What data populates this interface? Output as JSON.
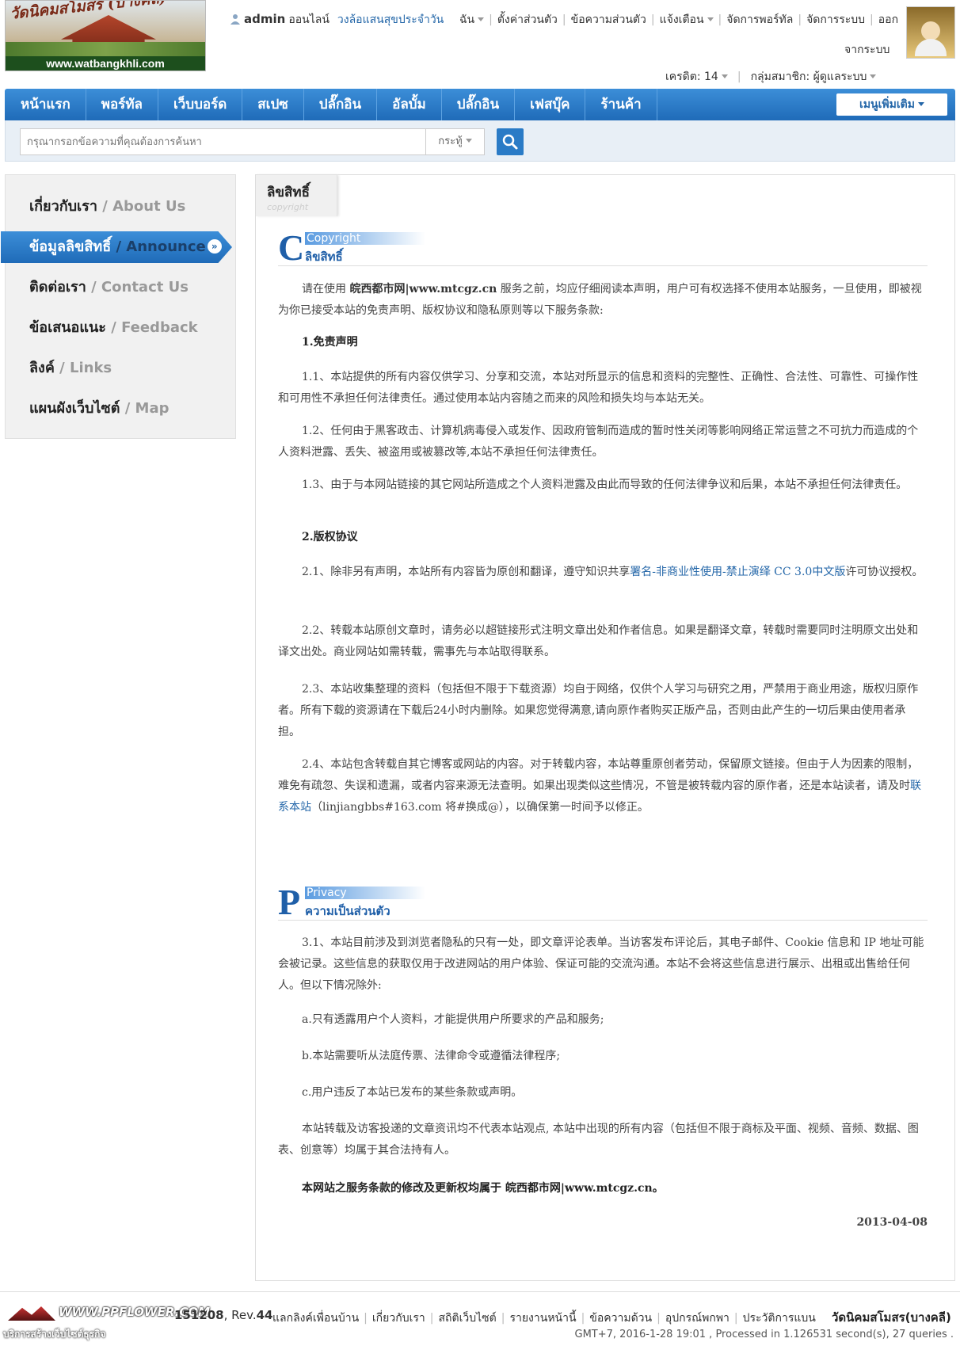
{
  "logo": {
    "title": "วัดนิคมสโมสร (บางคลี)",
    "url": "www.watbangkhli.com"
  },
  "topbar": {
    "username": "admin",
    "online": "ออนไลน์",
    "daily": "วงล้อแสนสุขประจำวัน",
    "links": [
      "ฉัน",
      "ตั้งค่าส่วนตัว",
      "ข้อความส่วนตัว",
      "แจ้งเตือน",
      "จัดการพอร์ทัล",
      "จัดการระบบ",
      "ออก"
    ],
    "logout_line2": "จากระบบ",
    "credits": "เครดิต: 14",
    "group": "กลุ่มสมาชิก: ผู้ดูแลระบบ"
  },
  "nav": {
    "items": [
      "หน้าแรก",
      "พอร์ทัล",
      "เว็บบอร์ด",
      "สเปซ",
      "ปลั๊กอิน",
      "อัลบั้ม",
      "ปลั๊กอิน",
      "เฟสบุ๊ค",
      "ร้านค้า"
    ],
    "more": "เมนูเพิ่มเติม"
  },
  "search": {
    "placeholder": "กรุณากรอกข้อความที่คุณต้องการค้นหา",
    "type": "กระทู้"
  },
  "sidebar": {
    "items": [
      {
        "th": "เกี่ยวกับเรา",
        "en": "/ About Us"
      },
      {
        "th": "ข้อมูลลิขสิทธิ์",
        "en": "/ Announce"
      },
      {
        "th": "ติดต่อเรา",
        "en": "/ Contact Us"
      },
      {
        "th": "ข้อเสนอแนะ",
        "en": "/ Feedback"
      },
      {
        "th": "ลิงค์",
        "en": "/ Links"
      },
      {
        "th": "แผนผังเว็บไซต์",
        "en": "/ Map"
      }
    ]
  },
  "tab": {
    "title": "ลิขสิทธิ์",
    "sub": "copyright"
  },
  "sec1": {
    "letter": "C",
    "en": "Copyright",
    "th": "ลิขสิทธิ์"
  },
  "sec2": {
    "letter": "P",
    "en": "Privacy",
    "th": "ความเป็นส่วนตัว"
  },
  "content": {
    "intro_a": "请在使用 ",
    "intro_site": "皖西都市网|www.mtcgz.cn",
    "intro_b": " 服务之前，均应仔细阅读本声明，用户可有权选择不使用本站服务，一旦使用，即被视为你已接受本站的免责声明、版权协议和隐私原则等以下服务条款:",
    "h1": "1.免责声明",
    "p11": "1.1、本站提供的所有内容仅供学习、分享和交流，本站对所显示的信息和资料的完整性、正确性、合法性、可靠性、可操作性和可用性不承担任何法律责任。通过使用本站内容随之而来的风险和损失均与本站无关。",
    "p12": "1.2、任何由于黑客政击、计算机病毒侵入或发作、因政府管制而造成的暂时性关闭等影响网络正常运营之不可抗力而造成的个人资料泄露、丢失、被盗用或被篡改等,本站不承担任何法律责任。",
    "p13": "1.3、由于与本网站链接的其它网站所造成之个人资料泄露及由此而导致的任何法律争议和后果，本站不承担任何法律责任。",
    "h2": "2.版权协议",
    "p21_a": "2.1、除非另有声明，本站所有内容皆为原创和翻译，遵守知识共享",
    "p21_link": "署名-非商业性使用-禁止演绎 CC 3.0中文版",
    "p21_b": "许可协议授权。",
    "p22": "2.2、转载本站原创文章时，请务必以超链接形式注明文章出处和作者信息。如果是翻译文章，转载时需要同时注明原文出处和译文出处。商业网站如需转载，需事先与本站取得联系。",
    "p23": "2.3、本站收集整理的资料（包括但不限于下载资源）均自于网络，仅供个人学习与研究之用，严禁用于商业用途，版权归原作者。所有下载的资源请在下载后24小时内删除。如果您觉得满意,请向原作者购买正版产品，否则由此产生的一切后果由使用者承担。",
    "p24_a": "2.4、本站包含转载自其它博客或网站的内容。对于转载内容，本站尊重原创者劳动，保留原文链接。但由于人为因素的限制，难免有疏忽、失误和遗漏，或者内容来源无法查明。如果出现类似这些情况，不管是被转载内容的原作者，还是本站读者，请及时",
    "p24_link": "联系本站",
    "p24_b": "（linjiangbbs#163.com 将#换成@），以确保第一时间予以修正。",
    "p31": "3.1、本站目前涉及到浏览者隐私的只有一处，即文章评论表单。当访客发布评论后，其电子邮件、Cookie 信息和 IP 地址可能会被记录。这些信息的获取仅用于改进网站的用户体验、保证可能的交流沟通。本站不会将这些信息进行展示、出租或出售给任何人。但以下情况除外:",
    "pa": "a.只有透露用户个人资料，才能提供用户所要求的产品和服务;",
    "pb": "b.本站需要听从法庭传票、法律命令或遵循法律程序;",
    "pc": "c.用户违反了本站已发布的某些条款或声明。",
    "p_notice": "本站转载及访客投递的文章资讯均不代表本站观点, 本站中出现的所有内容（包括但不限于商标及平面、视频、音频、数据、图表、创意等）均属于其合法持有人。",
    "p_final_a": "本网站之服务条款的修改及更新权均属于 ",
    "p_final_site": "皖西都市网|www.mtcgz.cn。",
    "date": "2013-04-08"
  },
  "footer": {
    "site": "WWW.PPFLOWER.COM",
    "version": "151208",
    "rev_label": ", Rev.",
    "rev": "44",
    "links": [
      "แลกลิงค์เพื่อนบ้าน",
      "เกี่ยวกับเรา",
      "สถิติเว็บไซต์",
      "รายงานหน้านี้",
      "ข้อความด้วน",
      "อุปกรณ์พกพา",
      "ประวัติการแบน"
    ],
    "brand": "วัดนิคมสโมสร(บางคลี)",
    "tagline": "บริการสร้างเว็บไซต์ธุรกิจ",
    "stat": "GMT+7, 2016-1-28 19:01 , Processed in 1.126531 second(s), 27 queries ."
  },
  "colors": {
    "accent": "#1f6bb8",
    "link": "#2366a8"
  }
}
